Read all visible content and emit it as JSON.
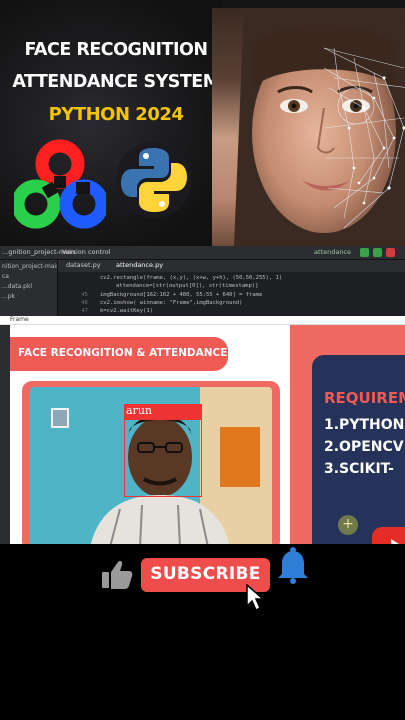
{
  "banner": {
    "line1": "FACE RECOGNITION",
    "line2": "ATTENDANCE SYSTEM",
    "line3": "PYTHON 2024",
    "colors": {
      "accent_yellow": "#f4c400",
      "opencv_red": "#ff1f1f",
      "opencv_green": "#2bd04a",
      "opencv_blue": "#1f5bff",
      "python_blue": "#3a74b0",
      "python_yellow": "#ffd43b"
    }
  },
  "ide": {
    "project": "...gnition_project-main",
    "vcs": "Version control",
    "run_config": "attendance",
    "sidebar": [
      "nition_project-main",
      "ca",
      "...",
      "...data.pkl",
      "...pk",
      "..."
    ],
    "tabs": [
      "dataset.py",
      "attendance.py"
    ],
    "line_numbers": [
      "",
      "",
      "45",
      "46",
      "47"
    ],
    "code": [
      "cv2.rectangle(frame, (x,y), (x+w, y+h), (50,50,255), 1)",
      "attendance=[str(output[0]), str(timestamp)]",
      "imgBackground[162:162 + 480, 55:55 + 640] = frame",
      "cv2.imshow( winname: \"Frame\",imgBackground)",
      "k=cv2.waitKey(1)"
    ]
  },
  "frame_window": {
    "title": "Frame",
    "heading": "FACE RECONGITION & ATTENDANCE",
    "detected_name": "arun",
    "requirements": {
      "heading": "REQUIREM",
      "items": [
        "1.PYTHON",
        "2.OPENCV",
        "3.SCIKIT-"
      ]
    }
  },
  "subscribe": {
    "label": "SUBSCRIBE"
  }
}
